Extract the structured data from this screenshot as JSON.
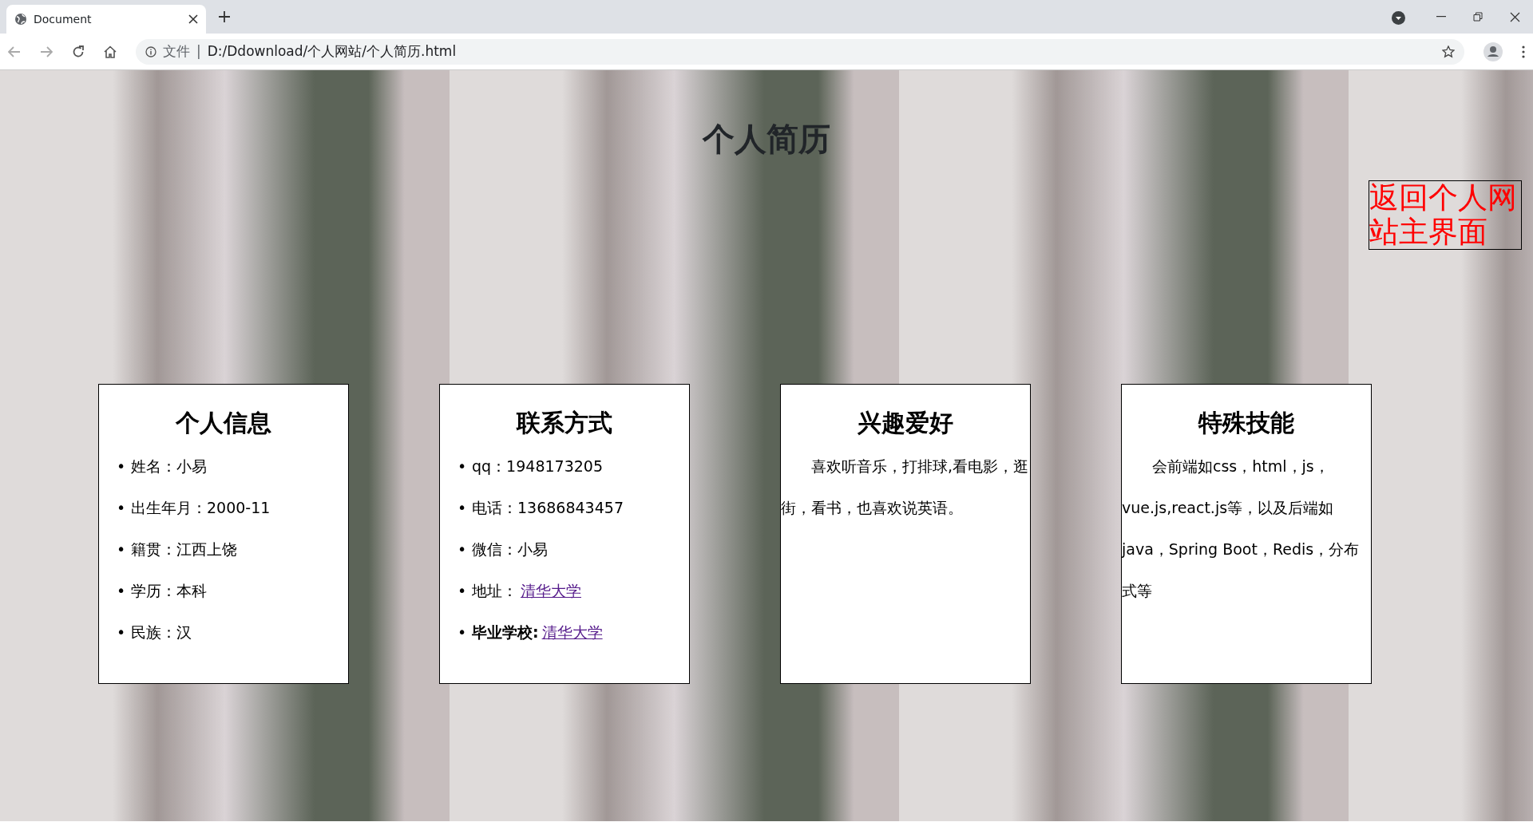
{
  "browser": {
    "tab": {
      "title": "Document",
      "selected": true
    },
    "address_bar": {
      "scheme_label": "文件",
      "separator": "|",
      "url": "D:/Ddownload/个人网站/个人简历.html"
    }
  },
  "page": {
    "title": "个人简历",
    "back_link": "返回个人网站主界面",
    "cards": [
      {
        "kind": "list",
        "title": "个人信息",
        "items": [
          {
            "marker": "•",
            "text": "姓名：小易"
          },
          {
            "marker": "•",
            "text": "出生年月：2000-11"
          },
          {
            "marker": "•",
            "text": "籍贯：江西上饶"
          },
          {
            "marker": "•",
            "text": "学历：本科"
          },
          {
            "marker": "•",
            "text": "民族：汉"
          }
        ]
      },
      {
        "kind": "list",
        "title": "联系方式",
        "items": [
          {
            "marker": "•",
            "text": "qq：1948173205"
          },
          {
            "marker": "•",
            "text": "电话：13686843457"
          },
          {
            "marker": "•",
            "text": "微信：小易"
          },
          {
            "marker": "•",
            "text": "地址：",
            "link": "清华大学"
          },
          {
            "marker": "•",
            "text": "**毕业学校:**",
            "link": "清华大学"
          }
        ]
      },
      {
        "kind": "paragraph",
        "title": "兴趣爱好",
        "text": "喜欢听音乐，打排球,看电影，逛街，看书，也喜欢说英语。"
      },
      {
        "kind": "paragraph",
        "title": "特殊技能",
        "text": "会前端如css，html，js，vue.js,react.js等，以及后端如java，Spring Boot，Redis，分布式等"
      }
    ]
  }
}
